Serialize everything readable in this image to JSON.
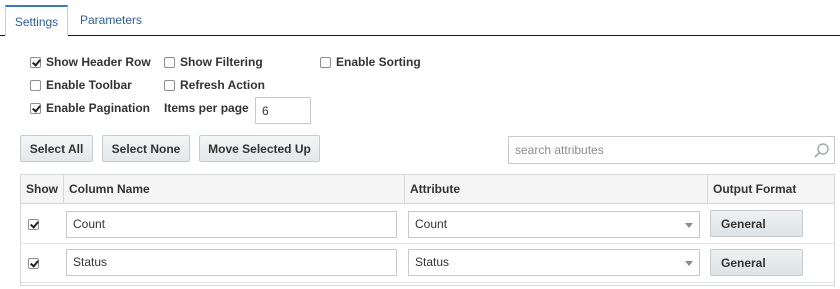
{
  "tabs": [
    {
      "label": "Settings",
      "active": true
    },
    {
      "label": "Parameters",
      "active": false
    }
  ],
  "options": {
    "show_header_row": {
      "label": "Show Header Row",
      "checked": true
    },
    "show_filtering": {
      "label": "Show Filtering",
      "checked": false
    },
    "enable_sorting": {
      "label": "Enable Sorting",
      "checked": false
    },
    "enable_toolbar": {
      "label": "Enable Toolbar",
      "checked": false
    },
    "refresh_action": {
      "label": "Refresh Action",
      "checked": false
    },
    "enable_pagination": {
      "label": "Enable Pagination",
      "checked": true
    },
    "items_per_page_label": "Items per page",
    "items_per_page_value": "6"
  },
  "buttons": {
    "select_all": "Select All",
    "select_none": "Select None",
    "move_selected_up": "Move Selected Up"
  },
  "search": {
    "placeholder": "search attributes"
  },
  "table": {
    "headers": [
      "Show",
      "Column Name",
      "Attribute",
      "Output Format"
    ],
    "rows": [
      {
        "show": true,
        "column_name": "Count",
        "attribute": "Count",
        "output_format": "General"
      },
      {
        "show": true,
        "column_name": "Status",
        "attribute": "Status",
        "output_format": "General"
      }
    ]
  }
}
